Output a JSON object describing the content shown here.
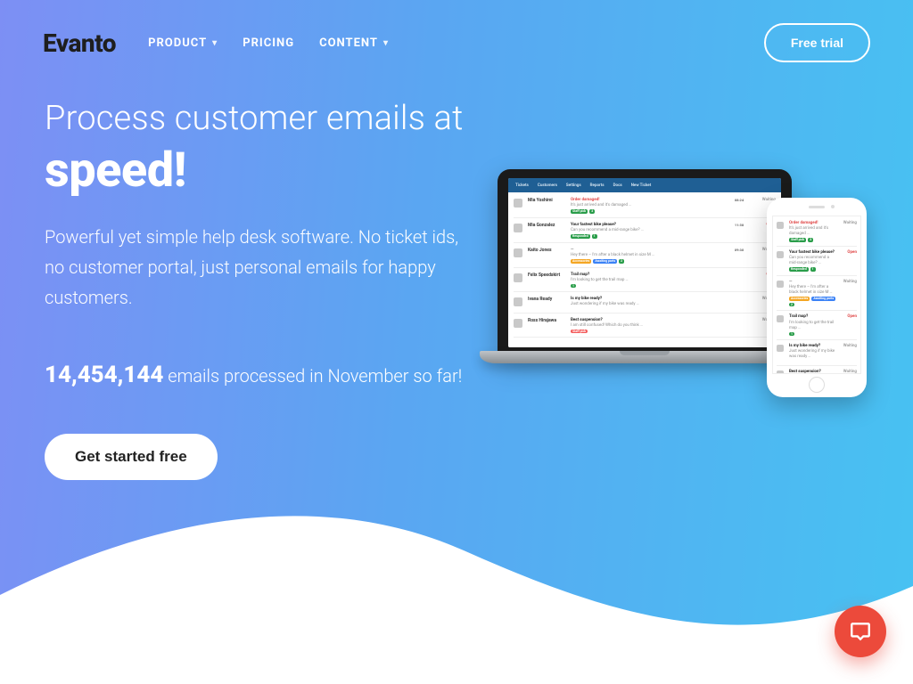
{
  "brand": "Evanto",
  "nav": {
    "items": [
      {
        "label": "PRODUCT",
        "has_dropdown": true
      },
      {
        "label": "PRICING",
        "has_dropdown": false
      },
      {
        "label": "CONTENT",
        "has_dropdown": true
      }
    ],
    "cta": "Free trial"
  },
  "hero": {
    "line1": "Process customer emails at",
    "line2": "speed!",
    "sub": "Powerful yet simple help desk software. No ticket ids, no customer portal, just personal emails for happy customers.",
    "counter_num": "14,454,144",
    "counter_rest": " emails processed in November so far!",
    "cta": "Get started free"
  },
  "mock_app": {
    "tabs": [
      "Tickets",
      "Customers",
      "Settings",
      "Reports",
      "Docs",
      "New Ticket"
    ],
    "tickets": [
      {
        "name": "Mia Yoshimi",
        "subject": "Order damaged!",
        "subject_color": "#e04848",
        "body": "It's just arrived and it's damaged …",
        "tags": [
          {
            "t": "Staff pick",
            "c": "#2a9d4a"
          },
          {
            "t": "3",
            "c": "#2a9d4a"
          }
        ],
        "time": "08:24",
        "status": "Waiting",
        "status_color": "#a0a0a0"
      },
      {
        "name": "Mia Gonzalez",
        "subject": "Your fastest bike please?",
        "subject_color": "#222",
        "body": "Can you recommend a mid-range bike? …",
        "tags": [
          {
            "t": "Responded",
            "c": "#2a9d4a"
          },
          {
            "t": "1",
            "c": "#2a9d4a"
          }
        ],
        "time": "11:58",
        "status": "Open",
        "status_color": "#e04848"
      },
      {
        "name": "Kaito Jones",
        "subject": "—",
        "subject_color": "#777",
        "body": "Hey there – I'm after a black helmet in size M …",
        "tags": [
          {
            "t": "Accessories",
            "c": "#f4a623"
          },
          {
            "t": "Awaiting parts",
            "c": "#3b82f6"
          },
          {
            "t": "2",
            "c": "#2a9d4a"
          }
        ],
        "time": "09:30",
        "status": "Waiting",
        "status_color": "#a0a0a0"
      },
      {
        "name": "Felix Speedskirt",
        "subject": "Trail map?",
        "subject_color": "#222",
        "body": "I'm looking to get the trail map …",
        "tags": [
          {
            "t": "1",
            "c": "#2a9d4a"
          }
        ],
        "time": "",
        "status": "Open",
        "status_color": "#e04848"
      },
      {
        "name": "Ivana Ready",
        "subject": "Is my bike ready?",
        "subject_color": "#222",
        "body": "Just wondering if my bike was ready …",
        "tags": [],
        "time": "",
        "status": "Waiting",
        "status_color": "#a0a0a0"
      },
      {
        "name": "Ross Hirajawa",
        "subject": "Best suspension?",
        "subject_color": "#222",
        "body": "I am still confused! Which do you think …",
        "tags": [
          {
            "t": "Staff pick",
            "c": "#f45b5b"
          }
        ],
        "time": "",
        "status": "Waiting",
        "status_color": "#a0a0a0"
      }
    ]
  },
  "fab": {
    "icon": "chat-icon"
  },
  "colors": {
    "accent": "#ec4a3b"
  }
}
